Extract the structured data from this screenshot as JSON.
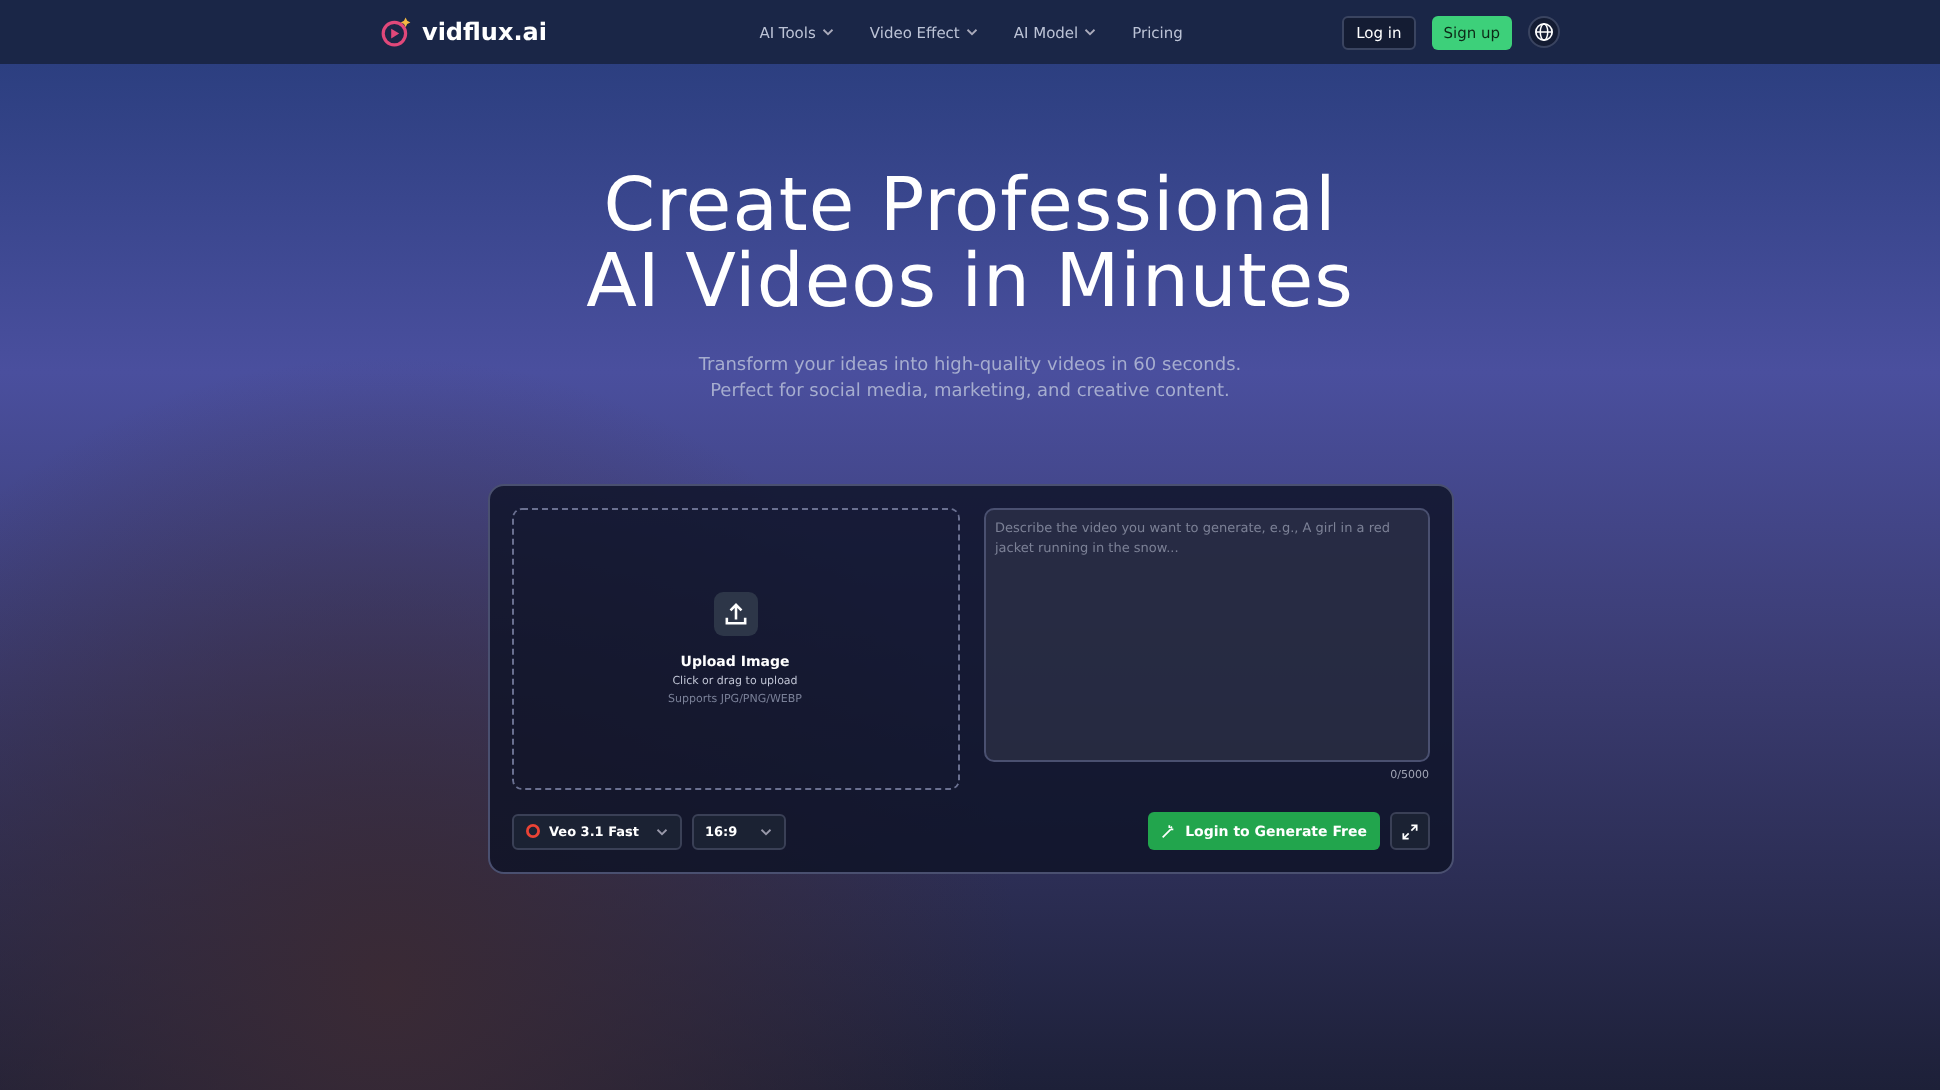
{
  "nav": {
    "logo": "vidflux.ai",
    "links": [
      {
        "label": "AI Tools",
        "dropdown": true
      },
      {
        "label": "Video Effect",
        "dropdown": true
      },
      {
        "label": "AI Model",
        "dropdown": true
      },
      {
        "label": "Pricing",
        "dropdown": false
      }
    ],
    "login": "Log in",
    "signup": "Sign up"
  },
  "hero": {
    "title_lines": [
      "Create Professional",
      "AI Videos in Minutes"
    ],
    "subtitle_lines": [
      "Transform your ideas into high-quality videos in 60 seconds.",
      "Perfect for social media, marketing, and creative content."
    ]
  },
  "generator": {
    "upload": {
      "title": "Upload Image",
      "hint": "Click or drag to upload",
      "formats": "Supports JPG/PNG/WEBP"
    },
    "prompt": {
      "placeholder": "Describe the video you want to generate, e.g., A girl in a red jacket running in the snow...",
      "counter": "0/5000"
    },
    "model": "Veo 3.1 Fast",
    "ratio": "16:9",
    "generate_button": "Login to Generate Free"
  }
}
